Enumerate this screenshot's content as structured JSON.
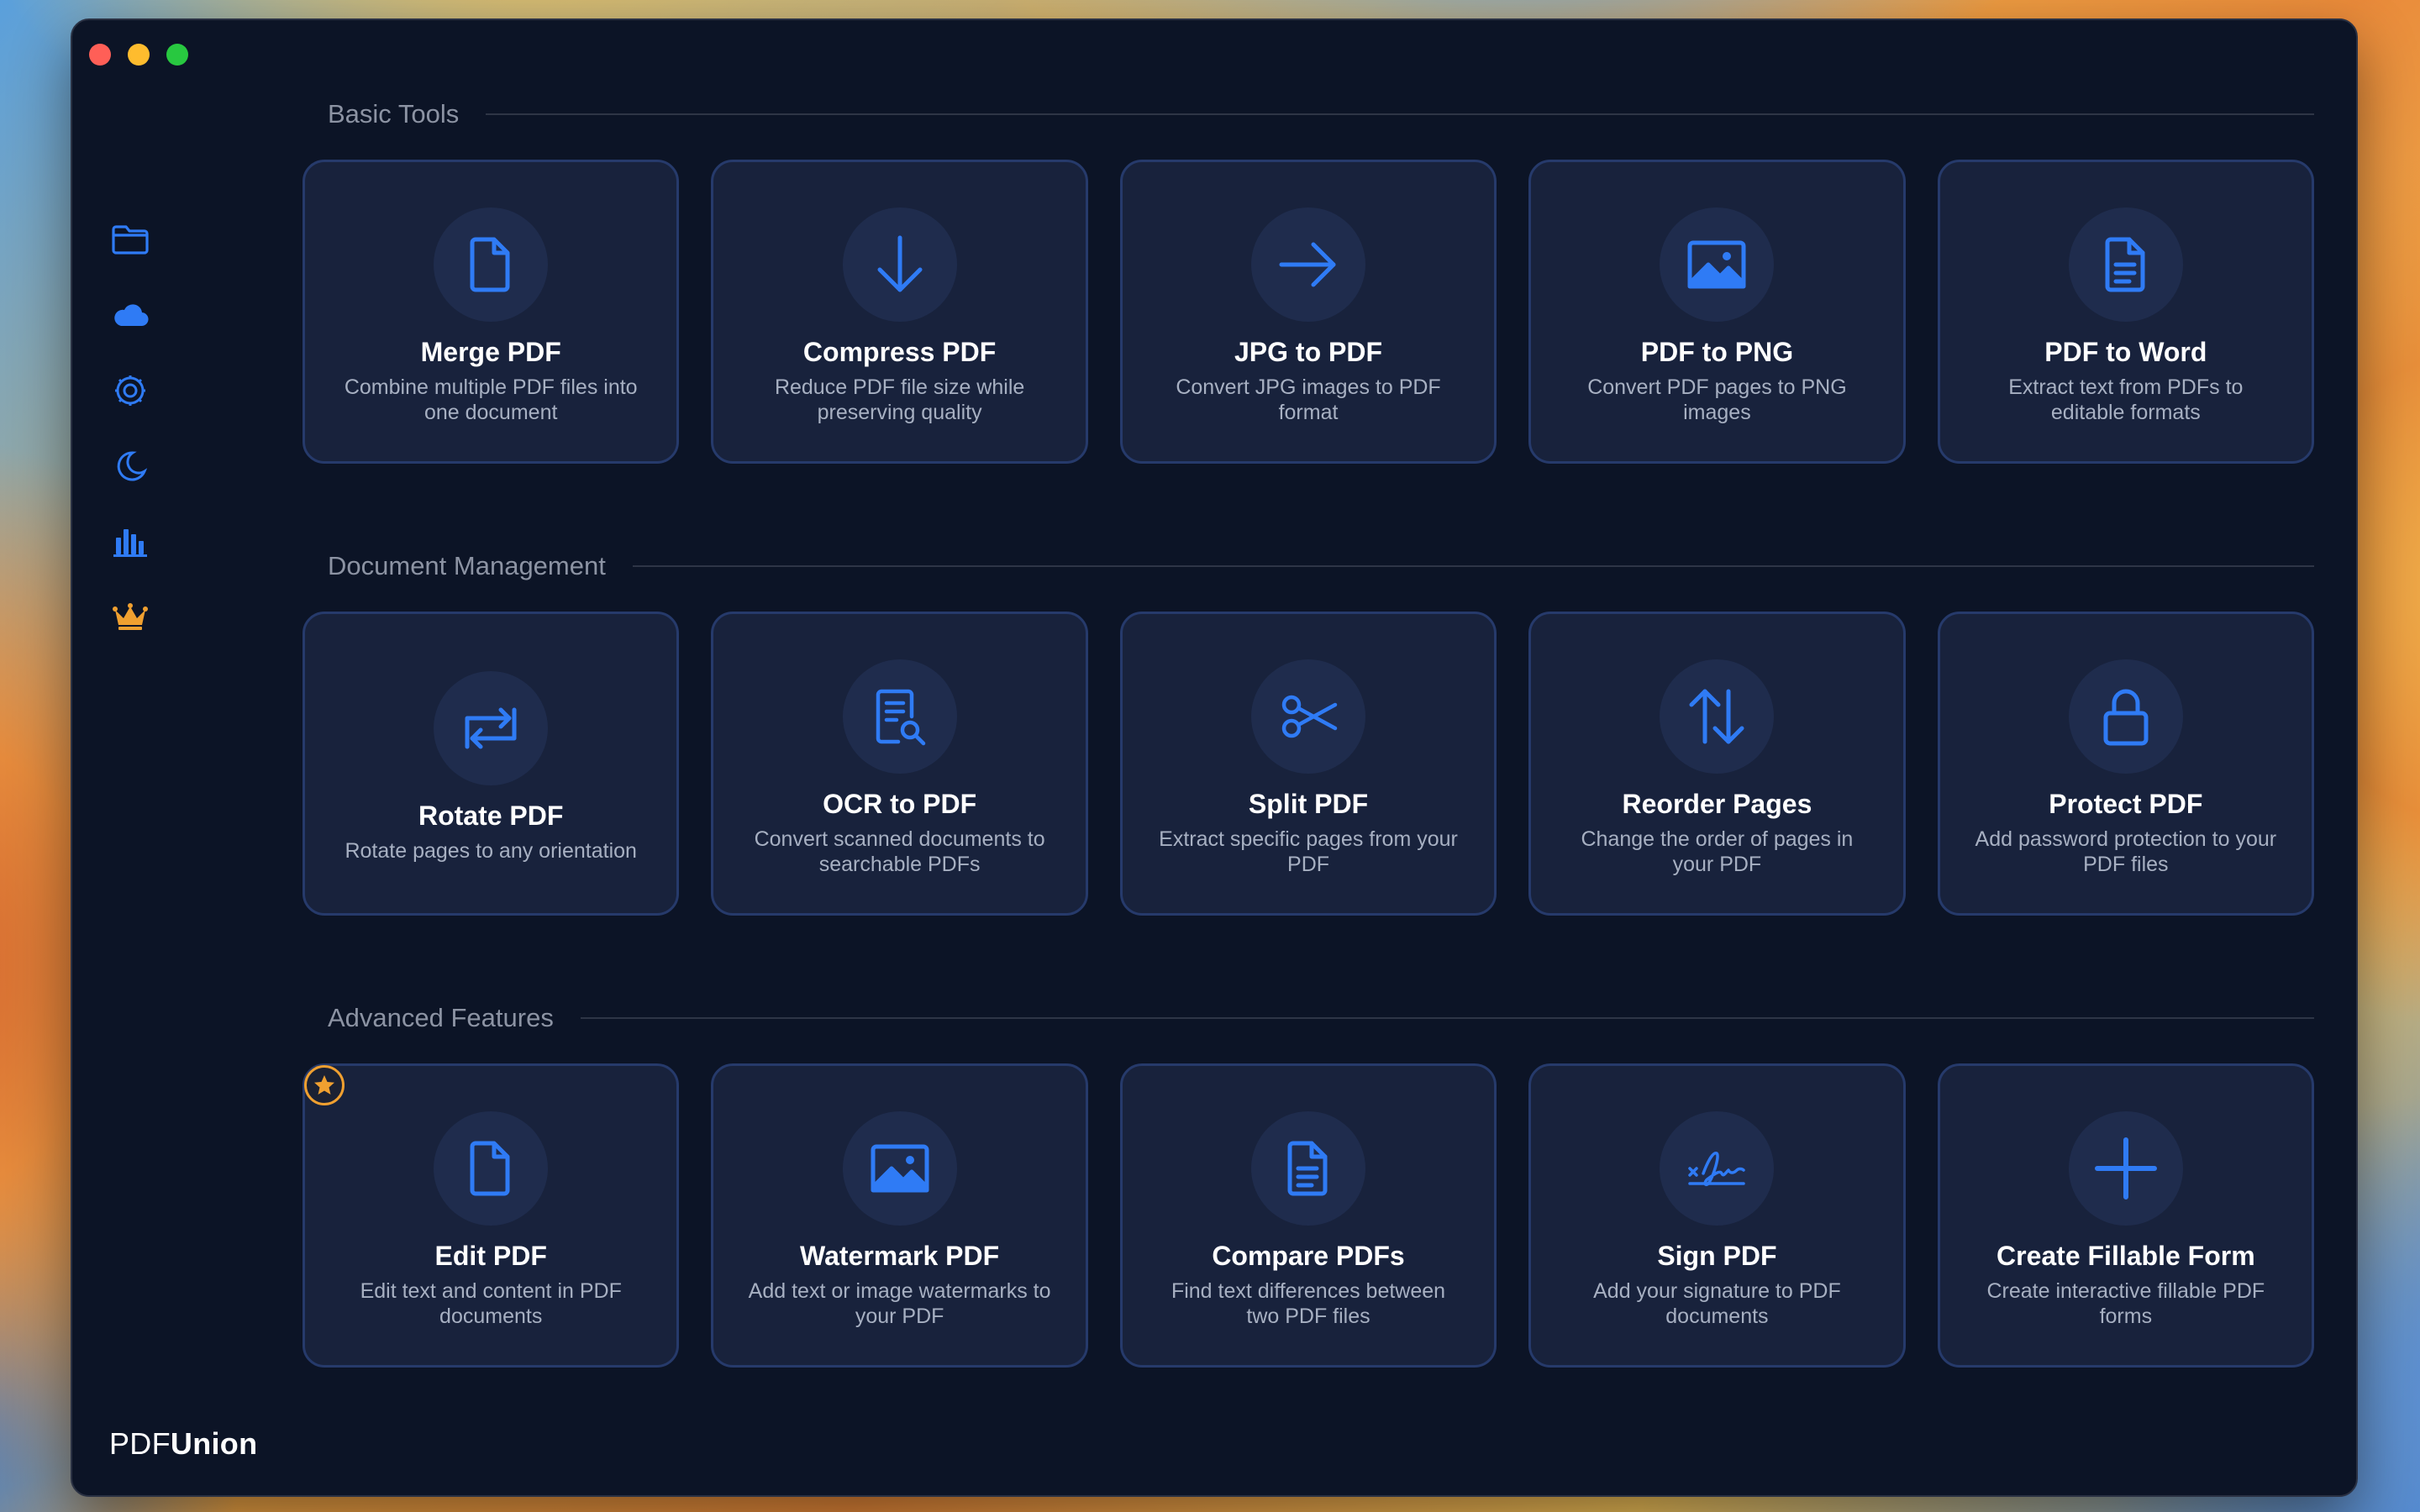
{
  "app": {
    "brand_prefix": "PDF",
    "brand_suffix": "Union"
  },
  "colors": {
    "accent": "#2f7bf5",
    "premium": "#f0a030",
    "card_bg": "#18223c",
    "window_bg": "#0c1426"
  },
  "sidebar": {
    "items": [
      {
        "icon": "folder-icon"
      },
      {
        "icon": "cloud-icon"
      },
      {
        "icon": "settings-gear-icon"
      },
      {
        "icon": "moon-icon"
      },
      {
        "icon": "bar-chart-icon"
      },
      {
        "icon": "crown-icon"
      }
    ]
  },
  "sections": [
    {
      "title": "Basic Tools",
      "cards": [
        {
          "icon": "document-icon",
          "title": "Merge PDF",
          "desc": "Combine multiple PDF files into one document"
        },
        {
          "icon": "arrow-down-icon",
          "title": "Compress PDF",
          "desc": "Reduce PDF file size while preserving quality"
        },
        {
          "icon": "arrow-right-icon",
          "title": "JPG to PDF",
          "desc": "Convert JPG images to PDF format"
        },
        {
          "icon": "image-icon",
          "title": "PDF to PNG",
          "desc": "Convert PDF pages to PNG images"
        },
        {
          "icon": "text-document-icon",
          "title": "PDF to Word",
          "desc": "Extract text from PDFs to editable formats"
        }
      ]
    },
    {
      "title": "Document Management",
      "cards": [
        {
          "icon": "rotate-icon",
          "title": "Rotate PDF",
          "desc": "Rotate pages to any orientation"
        },
        {
          "icon": "document-search-icon",
          "title": "OCR to PDF",
          "desc": "Convert scanned documents to searchable PDFs"
        },
        {
          "icon": "scissors-icon",
          "title": "Split PDF",
          "desc": "Extract specific pages from your PDF"
        },
        {
          "icon": "arrows-up-down-icon",
          "title": "Reorder Pages",
          "desc": "Change the order of pages in your PDF"
        },
        {
          "icon": "lock-icon",
          "title": "Protect PDF",
          "desc": "Add password protection to your PDF files"
        }
      ]
    },
    {
      "title": "Advanced Features",
      "cards": [
        {
          "icon": "document-icon",
          "title": "Edit PDF",
          "desc": "Edit text and content in PDF documents",
          "premium": true
        },
        {
          "icon": "image-icon",
          "title": "Watermark PDF",
          "desc": "Add text or image watermarks to your PDF"
        },
        {
          "icon": "text-document-icon",
          "title": "Compare PDFs",
          "desc": "Find text differences between two PDF files"
        },
        {
          "icon": "signature-icon",
          "title": "Sign PDF",
          "desc": "Add your signature to PDF documents"
        },
        {
          "icon": "plus-icon",
          "title": "Create Fillable Form",
          "desc": "Create interactive fillable PDF forms"
        }
      ]
    }
  ]
}
